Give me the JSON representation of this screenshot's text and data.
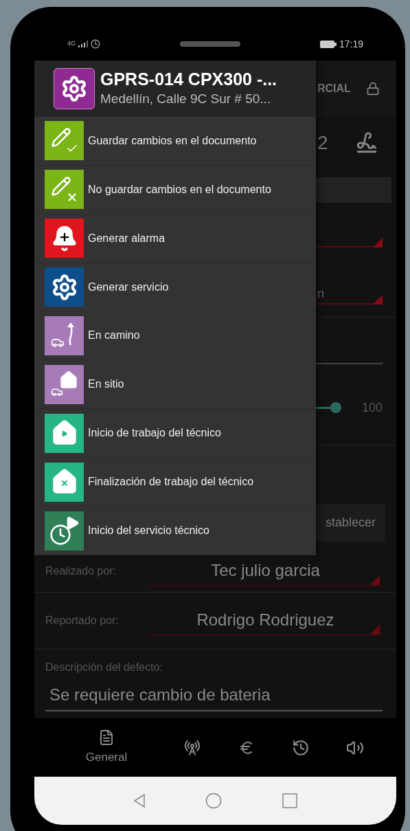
{
  "status_bar": {
    "network": "4G",
    "time": "17:19"
  },
  "drawer": {
    "title": "GPRS-014 CPX300 -...",
    "subtitle": "Medellín, Calle 9C Sur # 50...",
    "items": [
      {
        "kind": "save",
        "label": "Guardar cambios en el documento"
      },
      {
        "kind": "discard",
        "label": "No guardar cambios en el documento"
      },
      {
        "kind": "alarm",
        "label": "Generar alarma"
      },
      {
        "kind": "service",
        "label": "Generar servicio"
      },
      {
        "kind": "en_route",
        "label": "En camino"
      },
      {
        "kind": "on_site",
        "label": "En sitio"
      },
      {
        "kind": "work_start",
        "label": "Inicio de trabajo del técnico"
      },
      {
        "kind": "work_end",
        "label": "Finalización de trabajo del técnico"
      },
      {
        "kind": "service_start",
        "label": "Inicio del servicio técnico"
      }
    ]
  },
  "background": {
    "header_text": "RCIAL",
    "value_text": "2",
    "field_text": "n",
    "slider": {
      "level": 1,
      "reading": "100"
    },
    "button": "stablecer"
  },
  "form": {
    "fields": [
      {
        "label": "Realizado por:",
        "value": "Tec julio garcia"
      },
      {
        "label": "Reportado por:",
        "value": "Rodrigo Rodriguez"
      }
    ],
    "description": {
      "label": "Descripción del defecto:",
      "value": "Se requiere cambio de bateria"
    }
  },
  "bottom_nav": [
    {
      "kind": "document",
      "label": "General"
    },
    {
      "kind": "antenna"
    },
    {
      "kind": "euro"
    },
    {
      "kind": "history"
    },
    {
      "kind": "sound"
    }
  ]
}
